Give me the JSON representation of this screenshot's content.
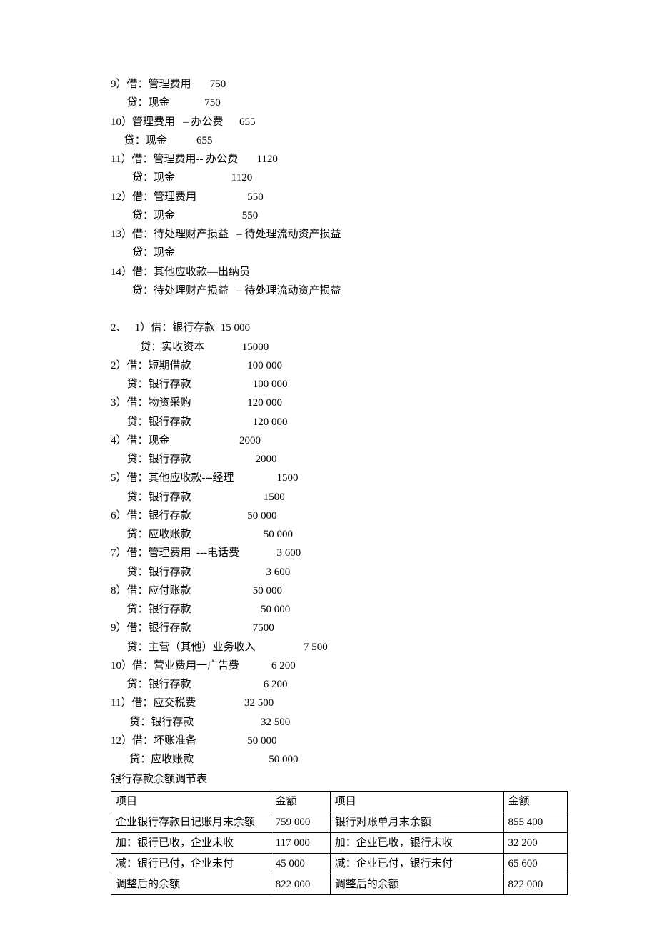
{
  "section1": [
    "9）借：管理费用       750",
    "      贷：现金             750",
    "10）管理费用   – 办公费      655",
    "     贷：现金           655",
    "11）借：管理费用-- 办公费       1120",
    "        贷：现金                     1120",
    "12）借：管理费用                   550",
    "        贷：现金                         550",
    "13）借：待处理财产损益   – 待处理流动资产损益",
    "        贷：现金",
    "14）借：其他应收款—出纳员",
    "        贷：待处理财产损益   – 待处理流动资产损益"
  ],
  "section2_header": "2、   1）借：银行存款  15 000",
  "section2": [
    "           贷：实收资本              15000",
    "2）借：短期借款                     100 000",
    "      贷：银行存款                       100 000",
    "3）借：物资采购                     120 000",
    "      贷：银行存款                       120 000",
    "4）借：现金                          2000",
    "      贷：银行存款                        2000",
    "5）借：其他应收款---经理                1500",
    "      贷：银行存款                           1500",
    "6）借：银行存款                     50 000",
    "      贷：应收账款                           50 000",
    "7）借：管理费用  ---电话费              3 600",
    "      贷：银行存款                            3 600",
    "8）借：应付账款                       50 000",
    "      贷：银行存款                          50 000",
    "9）借：银行存款                       7500",
    "      贷：主营（其他）业务收入                  7 500",
    "10）借：营业费用一广告费            6 200",
    "      贷：银行存款                           6 200",
    "11）借：应交税费                  32 500",
    "       贷：银行存款                         32 500",
    "12）借：坏账准备                   50 000",
    "       贷：应收账款                            50 000"
  ],
  "table_title": "银行存款余额调节表",
  "table": {
    "header": [
      "项目",
      "金额",
      "项目",
      "金额"
    ],
    "rows": [
      [
        "企业银行存款日记账月末余额",
        "759 000",
        "银行对账单月末余额",
        "855 400"
      ],
      [
        "加：银行已收，企业未收",
        "117 000",
        "加：企业已收，银行未收",
        "32 200"
      ],
      [
        "减：银行已付，企业未付",
        "45 000",
        "减：企业已付，银行未付",
        "65 600"
      ],
      [
        "调整后的余额",
        "822 000",
        "调整后的余额",
        "822 000"
      ]
    ]
  }
}
